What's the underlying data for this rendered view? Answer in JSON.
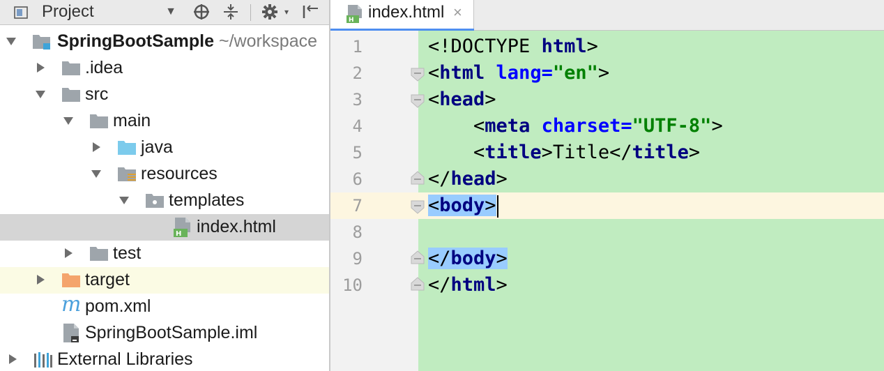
{
  "project_panel": {
    "title": "Project",
    "icons": [
      "dropdown-icon",
      "target-icon",
      "collapse-icon",
      "gear-icon",
      "hide-panel-icon"
    ],
    "tree": [
      {
        "label": "SpringBootSample",
        "suffix": "~/workspace",
        "expanded": true,
        "icon": "module-folder-icon"
      },
      {
        "label": ".idea",
        "expanded": false,
        "icon": "folder-icon"
      },
      {
        "label": "src",
        "expanded": true,
        "icon": "folder-icon"
      },
      {
        "label": "main",
        "expanded": true,
        "icon": "folder-icon"
      },
      {
        "label": "java",
        "expanded": false,
        "icon": "source-folder-icon"
      },
      {
        "label": "resources",
        "expanded": true,
        "icon": "resources-folder-icon"
      },
      {
        "label": "templates",
        "expanded": true,
        "icon": "package-folder-icon"
      },
      {
        "label": "index.html",
        "icon": "html-file-icon",
        "selected": true
      },
      {
        "label": "test",
        "expanded": false,
        "icon": "folder-icon"
      },
      {
        "label": "target",
        "expanded": false,
        "icon": "excluded-folder-icon"
      },
      {
        "label": "pom.xml",
        "icon": "maven-icon"
      },
      {
        "label": "SpringBootSample.iml",
        "icon": "iml-file-icon"
      },
      {
        "label": "External Libraries",
        "expanded": false,
        "icon": "libraries-icon"
      }
    ]
  },
  "editor": {
    "tab": {
      "label": "index.html",
      "close": "×"
    },
    "line_numbers": [
      "1",
      "2",
      "3",
      "4",
      "5",
      "6",
      "7",
      "8",
      "9",
      "10"
    ],
    "current_line": 7,
    "code": {
      "l1": {
        "open": "<!DOCTYPE ",
        "tag": "html",
        "close": ">"
      },
      "l2": {
        "open": "<",
        "tag": "html",
        "attr": " lang=",
        "value": "\"en\"",
        "close": ">"
      },
      "l3": {
        "open": "<",
        "tag": "head",
        "close": ">"
      },
      "l4": {
        "indent": "    ",
        "open": "<",
        "tag": "meta",
        "attr": " charset=",
        "value": "\"UTF-8\"",
        "close": ">"
      },
      "l5": {
        "indent": "    ",
        "open": "<",
        "tag": "title",
        "close": ">",
        "text": "Title",
        "open2": "</",
        "tag2": "title",
        "close2": ">"
      },
      "l6": {
        "open": "</",
        "tag": "head",
        "close": ">"
      },
      "l7": {
        "open": "<",
        "tag": "body",
        "close": ">"
      },
      "l9": {
        "open": "</",
        "tag": "body",
        "close": ">"
      },
      "l10": {
        "open": "</",
        "tag": "html",
        "close": ">"
      }
    }
  },
  "colors": {
    "code_background": "#c0ecc0",
    "selection": "#99ccff",
    "tag": "#000080",
    "attribute": "#0000ff",
    "string": "#008000",
    "current_line": "#fdf6e0"
  }
}
